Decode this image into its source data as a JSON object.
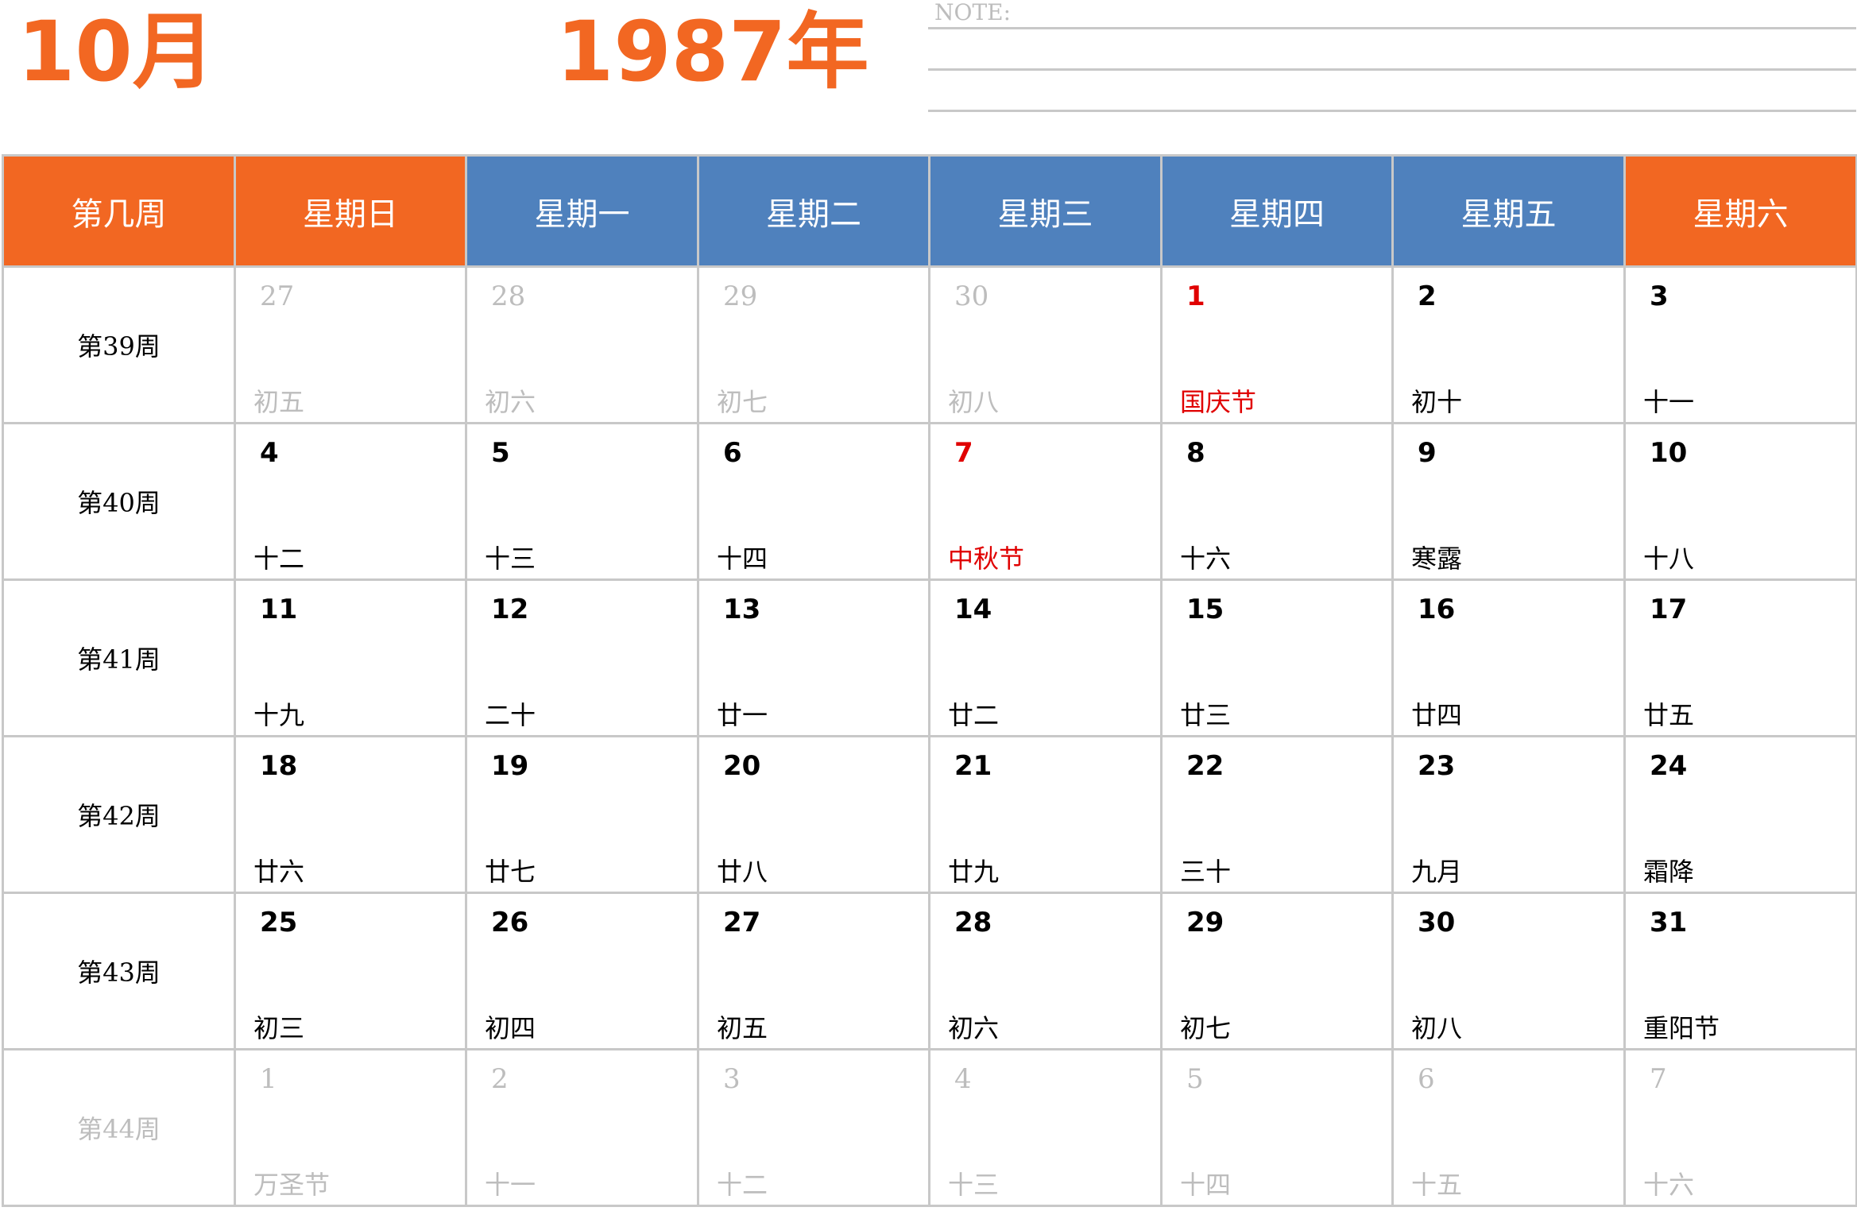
{
  "header": {
    "month": "10月",
    "year": "1987年",
    "note_label": "NOTE:"
  },
  "weekday_headers": [
    "第几周",
    "星期日",
    "星期一",
    "星期二",
    "星期三",
    "星期四",
    "星期五",
    "星期六"
  ],
  "colors": {
    "accent_orange": "#f26722",
    "header_blue": "#4f81bd",
    "holiday_red": "#e00000",
    "dim_gray": "#bdbdbd",
    "grid_line": "#c8c8c8"
  },
  "weeks": [
    {
      "label": "第39周",
      "dim": false,
      "days": [
        {
          "num": "27",
          "lunar": "初五",
          "dim": true
        },
        {
          "num": "28",
          "lunar": "初六",
          "dim": true
        },
        {
          "num": "29",
          "lunar": "初七",
          "dim": true
        },
        {
          "num": "30",
          "lunar": "初八",
          "dim": true
        },
        {
          "num": "1",
          "lunar": "国庆节",
          "red": true
        },
        {
          "num": "2",
          "lunar": "初十"
        },
        {
          "num": "3",
          "lunar": "十一"
        }
      ]
    },
    {
      "label": "第40周",
      "dim": false,
      "days": [
        {
          "num": "4",
          "lunar": "十二"
        },
        {
          "num": "5",
          "lunar": "十三"
        },
        {
          "num": "6",
          "lunar": "十四"
        },
        {
          "num": "7",
          "lunar": "中秋节",
          "red": true
        },
        {
          "num": "8",
          "lunar": "十六"
        },
        {
          "num": "9",
          "lunar": "寒露"
        },
        {
          "num": "10",
          "lunar": "十八"
        }
      ]
    },
    {
      "label": "第41周",
      "dim": false,
      "days": [
        {
          "num": "11",
          "lunar": "十九"
        },
        {
          "num": "12",
          "lunar": "二十"
        },
        {
          "num": "13",
          "lunar": "廿一"
        },
        {
          "num": "14",
          "lunar": "廿二"
        },
        {
          "num": "15",
          "lunar": "廿三"
        },
        {
          "num": "16",
          "lunar": "廿四"
        },
        {
          "num": "17",
          "lunar": "廿五"
        }
      ]
    },
    {
      "label": "第42周",
      "dim": false,
      "days": [
        {
          "num": "18",
          "lunar": "廿六"
        },
        {
          "num": "19",
          "lunar": "廿七"
        },
        {
          "num": "20",
          "lunar": "廿八"
        },
        {
          "num": "21",
          "lunar": "廿九"
        },
        {
          "num": "22",
          "lunar": "三十"
        },
        {
          "num": "23",
          "lunar": "九月"
        },
        {
          "num": "24",
          "lunar": "霜降"
        }
      ]
    },
    {
      "label": "第43周",
      "dim": false,
      "days": [
        {
          "num": "25",
          "lunar": "初三"
        },
        {
          "num": "26",
          "lunar": "初四"
        },
        {
          "num": "27",
          "lunar": "初五"
        },
        {
          "num": "28",
          "lunar": "初六"
        },
        {
          "num": "29",
          "lunar": "初七"
        },
        {
          "num": "30",
          "lunar": "初八"
        },
        {
          "num": "31",
          "lunar": "重阳节"
        }
      ]
    },
    {
      "label": "第44周",
      "dim": true,
      "days": [
        {
          "num": "1",
          "lunar": "万圣节",
          "dim": true
        },
        {
          "num": "2",
          "lunar": "十一",
          "dim": true
        },
        {
          "num": "3",
          "lunar": "十二",
          "dim": true
        },
        {
          "num": "4",
          "lunar": "十三",
          "dim": true
        },
        {
          "num": "5",
          "lunar": "十四",
          "dim": true
        },
        {
          "num": "6",
          "lunar": "十五",
          "dim": true
        },
        {
          "num": "7",
          "lunar": "十六",
          "dim": true
        }
      ]
    }
  ]
}
